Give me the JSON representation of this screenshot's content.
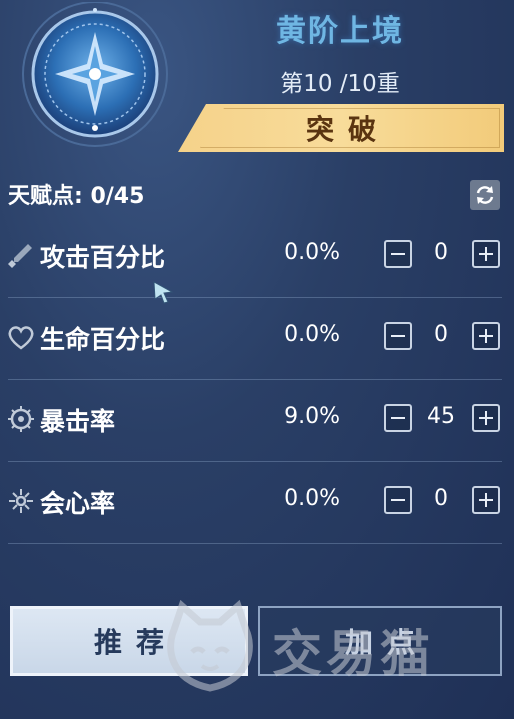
{
  "header": {
    "title": "黄阶上境",
    "stage": "第10 /10重",
    "breakthrough_label": "突破"
  },
  "talent": {
    "label": "天赋点: 0/45"
  },
  "stats": [
    {
      "name": "攻击百分比",
      "value": "0.0%",
      "count": "0",
      "icon": "sword-icon"
    },
    {
      "name": "生命百分比",
      "value": "0.0%",
      "count": "0",
      "icon": "heart-icon"
    },
    {
      "name": "暴击率",
      "value": "9.0%",
      "count": "45",
      "icon": "crit-gear-icon"
    },
    {
      "name": "会心率",
      "value": "0.0%",
      "count": "0",
      "icon": "sparkle-icon"
    }
  ],
  "buttons": {
    "recommend": "推荐",
    "add_points": "加点"
  },
  "watermark": {
    "text": "交易猫"
  },
  "colors": {
    "background": "#2a3f66",
    "title": "#6fb6e3",
    "breakthrough": "#f5d28a",
    "breakthrough_text": "#5a3410"
  }
}
